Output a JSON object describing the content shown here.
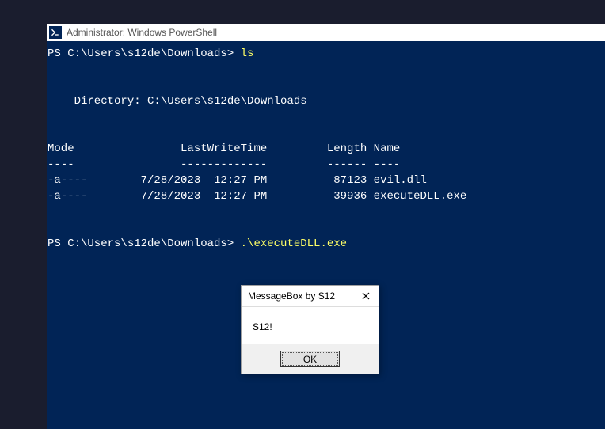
{
  "window": {
    "title": "Administrator: Windows PowerShell"
  },
  "prompt1": {
    "path": "PS C:\\Users\\s12de\\Downloads> ",
    "command": "ls"
  },
  "listing": {
    "dir_label": "    Directory: C:\\Users\\s12de\\Downloads",
    "header": "Mode                LastWriteTime         Length Name",
    "sep": "----                -------------         ------ ----",
    "row1": "-a----        7/28/2023  12:27 PM          87123 evil.dll",
    "row2": "-a----        7/28/2023  12:27 PM          39936 executeDLL.exe"
  },
  "prompt2": {
    "path": "PS C:\\Users\\s12de\\Downloads> ",
    "command": ".\\executeDLL.exe"
  },
  "msgbox": {
    "title": "MessageBox by S12",
    "body": "S12!",
    "ok": "OK"
  }
}
